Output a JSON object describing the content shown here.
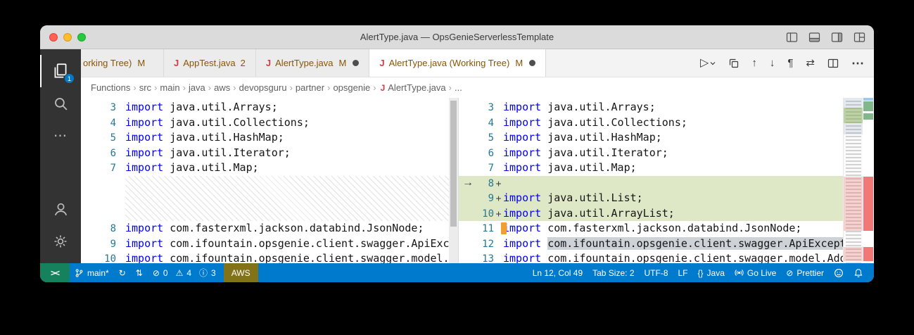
{
  "window": {
    "title": "AlertType.java — OpsGenieServerlessTemplate"
  },
  "activity_bar": {
    "explorer_badge": "1"
  },
  "tabs": {
    "partial": {
      "label": "orking Tree)",
      "git": "M"
    },
    "items": [
      {
        "label": "AppTest.java",
        "badge": "2"
      },
      {
        "label": "AlertType.java",
        "git": "M"
      },
      {
        "label": "AlertType.java (Working Tree)",
        "git": "M"
      }
    ]
  },
  "breadcrumb": {
    "separator": "›",
    "items": [
      "Functions",
      "src",
      "main",
      "java",
      "aws",
      "devopsguru",
      "partner",
      "opsgenie"
    ],
    "file": "AlertType.java",
    "more": "..."
  },
  "icons": {
    "java": "J",
    "run": "▷",
    "prev_change": "↑",
    "next_change": "↓",
    "whitespace": "¶",
    "swap": "⇄",
    "more": "⋯",
    "diff_arrow": "→",
    "remote": "><",
    "sync": "↻",
    "compare": "⇅",
    "error": "⊘",
    "warning": "⚠",
    "info": "ⓘ",
    "braces": "{}",
    "prettier_mark": "⊘"
  },
  "diff": {
    "left": {
      "rows": [
        {
          "num": "3",
          "kw": "import",
          "rest": " java.util.Arrays;"
        },
        {
          "num": "4",
          "kw": "import",
          "rest": " java.util.Collections;"
        },
        {
          "num": "5",
          "kw": "import",
          "rest": " java.util.HashMap;"
        },
        {
          "num": "6",
          "kw": "import",
          "rest": " java.util.Iterator;"
        },
        {
          "num": "7",
          "kw": "import",
          "rest": " java.util.Map;"
        },
        {
          "hatch": 3
        },
        {
          "num": "8",
          "kw": "import",
          "rest": " com.fasterxml.jackson.databind.JsonNode;"
        },
        {
          "num": "9",
          "kw": "import",
          "rest": " com.ifountain.opsgenie.client.swagger.ApiExcept"
        },
        {
          "num": "10",
          "kw": "import",
          "rest": " com.ifountain.opsgenie.client.swagger.model.Add"
        }
      ]
    },
    "right": {
      "rows": [
        {
          "num": "3",
          "kw": "import",
          "rest": " java.util.Arrays;"
        },
        {
          "num": "4",
          "kw": "import",
          "rest": " java.util.Collections;"
        },
        {
          "num": "5",
          "kw": "import",
          "rest": " java.util.HashMap;"
        },
        {
          "num": "6",
          "kw": "import",
          "rest": " java.util.Iterator;"
        },
        {
          "num": "7",
          "kw": "import",
          "rest": " java.util.Map;"
        },
        {
          "num": "8",
          "sign": "+",
          "added": true,
          "kw": "",
          "rest": ""
        },
        {
          "num": "9",
          "sign": "+",
          "added": true,
          "kw": "import",
          "rest": " java.util.List;"
        },
        {
          "num": "10",
          "sign": "+",
          "added": true,
          "kw": "import",
          "rest": " java.util.ArrayList;"
        },
        {
          "num": "11",
          "cursor": true,
          "kw": "import",
          "rest": " com.fasterxml.jackson.databind.JsonNode;"
        },
        {
          "num": "12",
          "kw": "import",
          "rest": " ",
          "sel": "com.ifountain.opsgenie.client.swagger.ApiException"
        },
        {
          "num": "13",
          "kw": "import",
          "rest": " com.ifountain.opsgenie.client.swagger.model.AddAle"
        }
      ]
    }
  },
  "statusbar": {
    "branch": "main*",
    "errors": "0",
    "warnings": "4",
    "infos": "3",
    "aws": "AWS",
    "cursor": "Ln 12, Col 49",
    "tab_size": "Tab Size: 2",
    "encoding": "UTF-8",
    "eol": "LF",
    "language": "Java",
    "go_live": "Go Live",
    "prettier": "Prettier"
  },
  "colors": {
    "accent": "#007acc",
    "remote_bg": "#16825d",
    "aws_bg": "#837318",
    "git_modified": "#895503",
    "keyword": "#0000ff",
    "line_number": "#237893",
    "added_line_bg": "#dfe8c6",
    "ruler_added": "#81b88b",
    "ruler_removed": "#f27878"
  }
}
